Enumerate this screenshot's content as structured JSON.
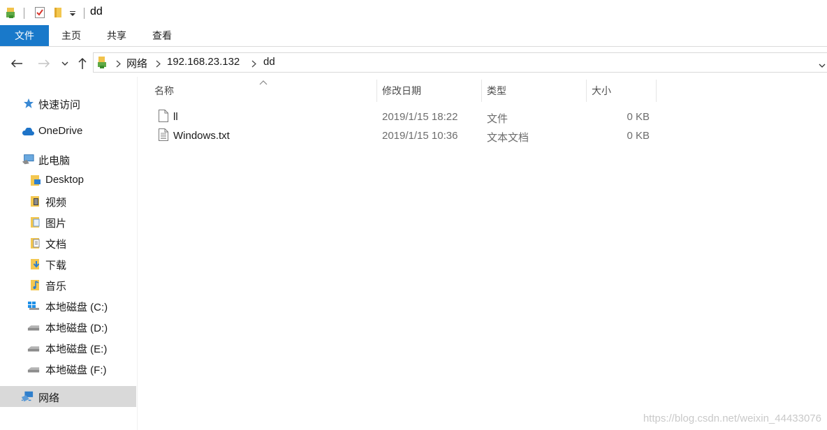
{
  "window": {
    "title": "dd"
  },
  "ribbon": {
    "tabs": [
      {
        "label": "文件"
      },
      {
        "label": "主页"
      },
      {
        "label": "共享"
      },
      {
        "label": "查看"
      }
    ]
  },
  "address": {
    "crumbs": [
      "网络",
      "192.168.23.132",
      "dd"
    ]
  },
  "sidebar": {
    "items": [
      {
        "label": "快速访问",
        "icon": "star-icon"
      },
      {
        "label": "OneDrive",
        "icon": "cloud-icon"
      },
      {
        "label": "此电脑",
        "icon": "computer-icon"
      },
      {
        "label": "Desktop",
        "icon": "desktop-folder-icon"
      },
      {
        "label": "视频",
        "icon": "video-folder-icon"
      },
      {
        "label": "图片",
        "icon": "pictures-folder-icon"
      },
      {
        "label": "文档",
        "icon": "documents-folder-icon"
      },
      {
        "label": "下载",
        "icon": "downloads-folder-icon"
      },
      {
        "label": "音乐",
        "icon": "music-folder-icon"
      },
      {
        "label": "本地磁盘 (C:)",
        "icon": "windows-drive-icon"
      },
      {
        "label": "本地磁盘 (D:)",
        "icon": "drive-icon"
      },
      {
        "label": "本地磁盘 (E:)",
        "icon": "drive-icon"
      },
      {
        "label": "本地磁盘 (F:)",
        "icon": "drive-icon"
      },
      {
        "label": "网络",
        "icon": "network-icon",
        "selected": true
      }
    ]
  },
  "files": {
    "columns": [
      "名称",
      "修改日期",
      "类型",
      "大小"
    ],
    "rows": [
      {
        "name": "ll",
        "modified": "2019/1/15 18:22",
        "type": "文件",
        "size": "0 KB",
        "icon": "blank-file-icon"
      },
      {
        "name": "Windows.txt",
        "modified": "2019/1/15 10:36",
        "type": "文本文档",
        "size": "0 KB",
        "icon": "text-file-icon"
      }
    ]
  },
  "watermark": "https://blog.csdn.net/weixin_44433076",
  "colors": {
    "accent": "#1979ca",
    "selected_bg": "#d9d9d9"
  }
}
